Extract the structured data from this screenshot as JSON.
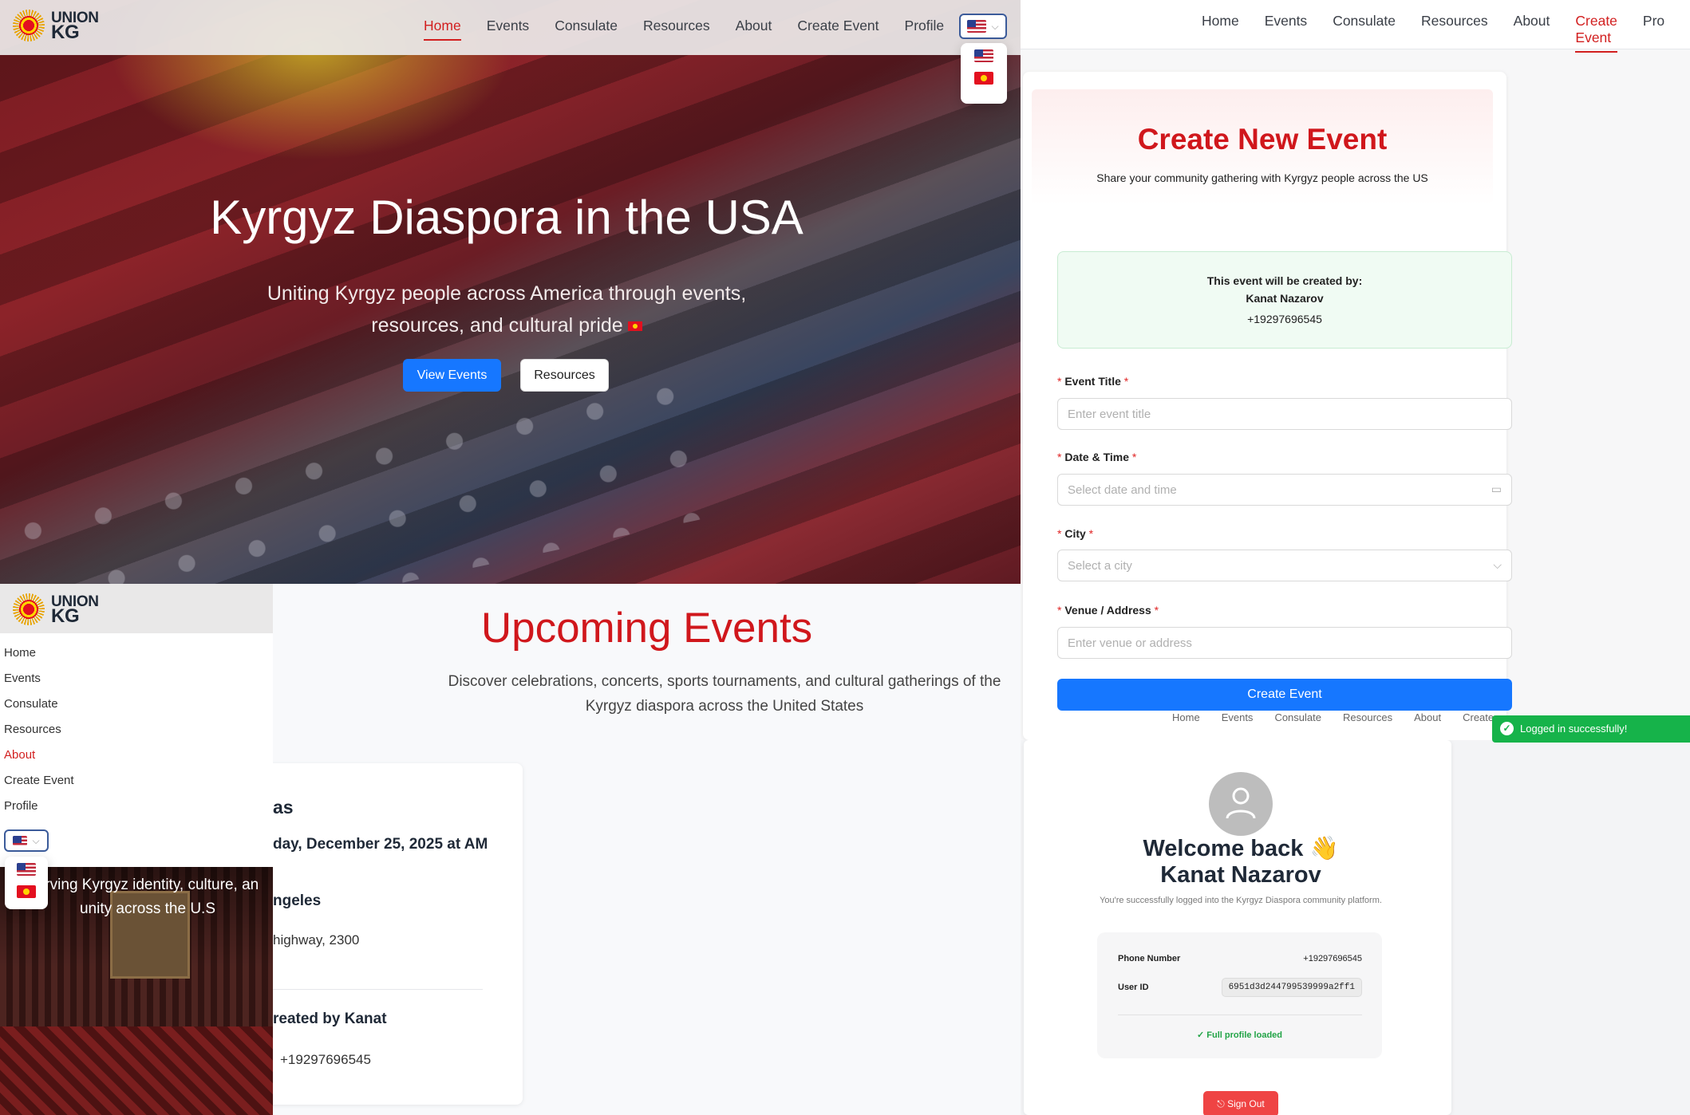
{
  "hero": {
    "logo": {
      "line1": "UNION",
      "line2": "KG"
    },
    "nav": [
      "Home",
      "Events",
      "Consulate",
      "Resources",
      "About",
      "Create Event",
      "Profile"
    ],
    "active_nav": "Home",
    "title": "Kyrgyz Diaspora in the USA",
    "subtitle": "Uniting Kyrgyz people across America through events, resources, and cultural pride",
    "buttons": {
      "view_events": "View Events",
      "resources": "Resources"
    },
    "languages": [
      "us-flag-icon",
      "kg-flag-icon"
    ]
  },
  "create_event": {
    "nav": [
      "Home",
      "Events",
      "Consulate",
      "Resources",
      "About",
      "Create Event",
      "Pro"
    ],
    "active_nav": "Create Event",
    "title": "Create New Event",
    "subtitle": "Share your community gathering with Kyrgyz people across the US",
    "creator": {
      "heading": "This event will be created by:",
      "name": "Kanat Nazarov",
      "phone": "+19297696545"
    },
    "fields": {
      "title": {
        "label": "Event Title",
        "placeholder": "Enter event title"
      },
      "datetime": {
        "label": "Date & Time",
        "placeholder": "Select date and time"
      },
      "city": {
        "label": "City",
        "placeholder": "Select a city"
      },
      "venue": {
        "label": "Venue / Address",
        "placeholder": "Enter venue or address"
      }
    },
    "submit": "Create Event",
    "lower_nav": [
      "Home",
      "Events",
      "Consulate",
      "Resources",
      "About",
      "Create"
    ],
    "toast": "Logged in successfully!"
  },
  "welcome": {
    "greeting": "Welcome back 👋",
    "name": "Kanat Nazarov",
    "subtitle": "You're successfully logged into the Kyrgyz Diaspora community platform.",
    "phone_label": "Phone Number",
    "phone": "+19297696545",
    "user_id_label": "User ID",
    "user_id": "6951d3d244799539999a2ff1",
    "status": "✓ Full profile loaded",
    "sign_out": "Sign Out"
  },
  "events": {
    "title": "Upcoming Events",
    "subtitle": "Discover celebrations, concerts, sports tournaments, and cultural gatherings of the Kyrgyz diaspora across the United States",
    "card": {
      "name": "as",
      "date": "day, December 25, 2025 at AM",
      "city": "ngeles",
      "address": "highway, 2300",
      "creator": "reated by Kanat",
      "phone": "+19297696545"
    }
  },
  "mobile": {
    "logo": {
      "line1": "UNION",
      "line2": "KG"
    },
    "menu": [
      "Home",
      "Events",
      "Consulate",
      "Resources",
      "About",
      "Create Event",
      "Profile"
    ],
    "active_menu": "About",
    "hero_text": "erving Kyrgyz identity, culture, an unity across the U.S"
  },
  "colors": {
    "accent_red": "#d0171c",
    "primary_blue": "#1677ff",
    "success_green": "#16b34a"
  }
}
